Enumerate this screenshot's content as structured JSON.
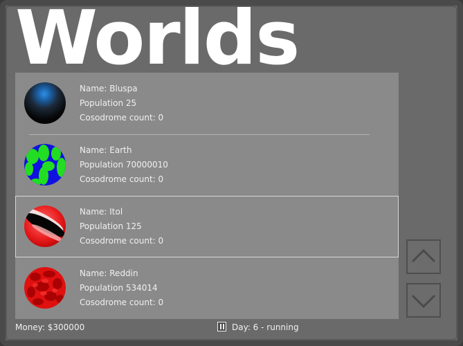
{
  "screen": {
    "title": "Worlds"
  },
  "worlds": [
    {
      "name_line": "Name: Bluspa",
      "population_line": "Population 25",
      "cosodrome_line": "Cosodrome count: 0",
      "planet_icon": "bluspa-planet-icon",
      "selected": false
    },
    {
      "name_line": "Name: Earth",
      "population_line": "Population 70000010",
      "cosodrome_line": "Cosodrome count: 0",
      "planet_icon": "earth-planet-icon",
      "selected": false
    },
    {
      "name_line": "Name: Itol",
      "population_line": "Population 125",
      "cosodrome_line": "Cosodrome count: 0",
      "planet_icon": "itol-planet-icon",
      "selected": true
    },
    {
      "name_line": "Name: Reddin",
      "population_line": "Population 534014",
      "cosodrome_line": "Cosodrome count: 0",
      "planet_icon": "reddin-planet-icon",
      "selected": false
    }
  ],
  "scroll": {
    "up_icon": "chevron-up-icon",
    "down_icon": "chevron-down-icon"
  },
  "status": {
    "money": "Money: $300000",
    "day": "Day: 6 - running",
    "pause_icon": "pause-icon"
  },
  "colors": {
    "background": "#6a6a6a",
    "list_background": "#8a8a8a",
    "text": "#f0f0f0",
    "title": "#ffffff"
  }
}
